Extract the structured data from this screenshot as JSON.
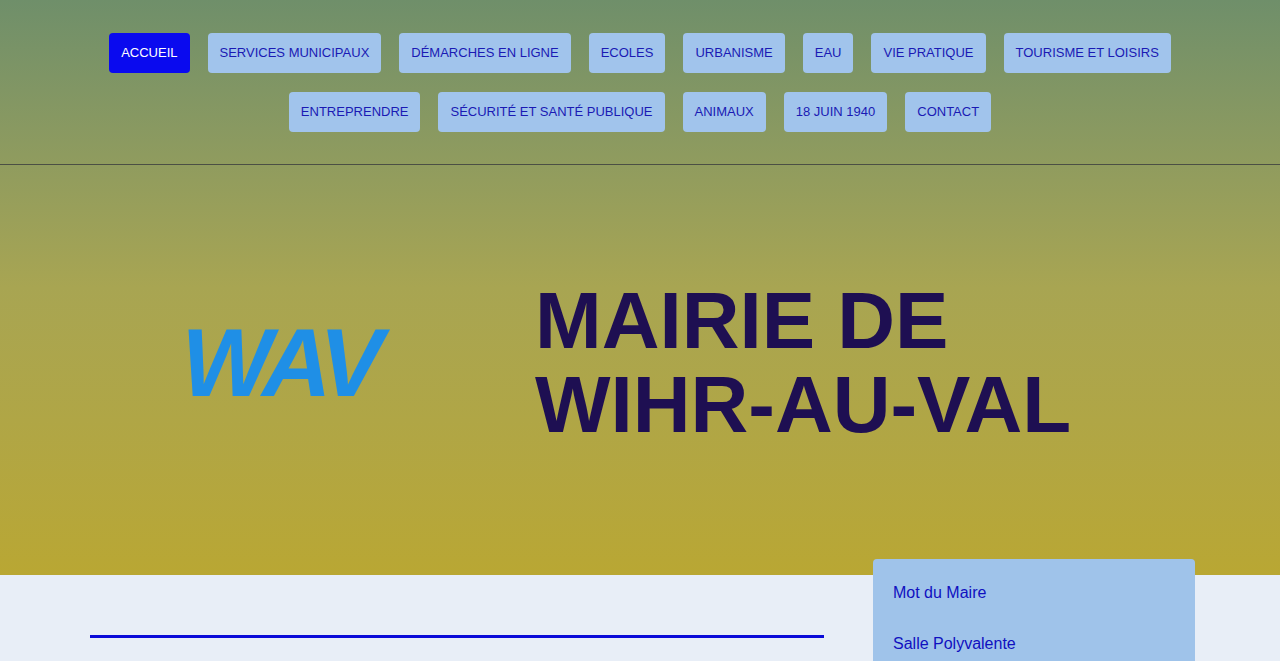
{
  "nav": {
    "rows": [
      [
        {
          "label": "ACCUEIL",
          "selected": true
        },
        {
          "label": "SERVICES MUNICIPAUX",
          "selected": false
        },
        {
          "label": "DÉMARCHES EN LIGNE",
          "selected": false
        },
        {
          "label": "ECOLES",
          "selected": false
        },
        {
          "label": "URBANISME",
          "selected": false
        },
        {
          "label": "EAU",
          "selected": false
        },
        {
          "label": "VIE PRATIQUE",
          "selected": false
        },
        {
          "label": "TOURISME ET LOISIRS",
          "selected": false
        }
      ],
      [
        {
          "label": "ENTREPRENDRE",
          "selected": false
        },
        {
          "label": "SÉCURITÉ ET SANTÉ PUBLIQUE",
          "selected": false
        },
        {
          "label": "ANIMAUX",
          "selected": false
        },
        {
          "label": "18 JUIN 1940",
          "selected": false
        },
        {
          "label": "CONTACT",
          "selected": false
        }
      ]
    ]
  },
  "logo": "WAV",
  "title": [
    "MAIRIE DE",
    "WIHR-AU-VAL"
  ],
  "sidebar": {
    "items": [
      "Mot du Maire",
      "Salle Polyvalente"
    ]
  }
}
